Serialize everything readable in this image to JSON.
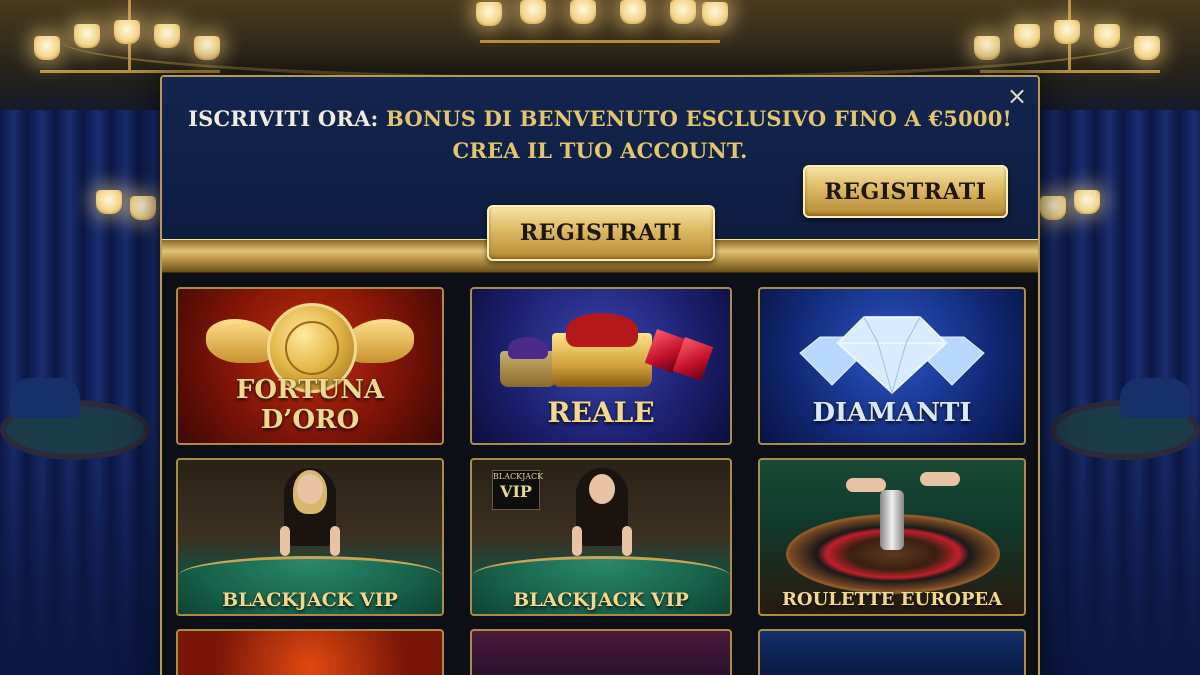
{
  "modal": {
    "close_label": "×",
    "promo_part1": "ISCRIVITI ORA: ",
    "promo_part2": "BONUS DI BENVENUTO ESCLUSIVO FINO A €5000!",
    "promo_line2": "CREA IL TUO ACCOUNT.",
    "register_button_top": "REGISTRATI",
    "register_button_center": "REGISTRATI"
  },
  "games": [
    {
      "label_line1": "FORTUNA",
      "label_line2": "D’ORO"
    },
    {
      "label": "REALE"
    },
    {
      "label": "DIAMANTI"
    },
    {
      "label": "BLACKJACK VIP"
    },
    {
      "label": "BLACKJACK VIP",
      "sign_small": "BLACKJACK",
      "sign_big": "VIP"
    },
    {
      "label": "ROULETTE EUROPEA"
    }
  ],
  "colors": {
    "accent_gold": "#e3c56d",
    "header_blue": "#14264f",
    "button_text": "#1e1608"
  }
}
